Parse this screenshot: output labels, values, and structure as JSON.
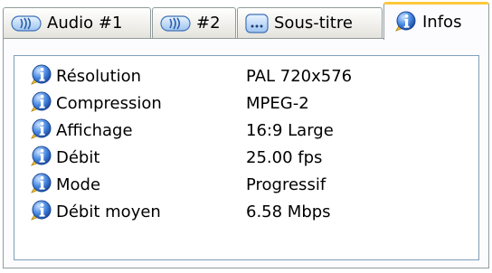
{
  "tabs": [
    {
      "label": "Audio #1",
      "icon": "audio-wave-icon",
      "active": false
    },
    {
      "label": "#2",
      "icon": "audio-wave-icon",
      "active": false
    },
    {
      "label": "Sous-titre",
      "icon": "subtitle-icon",
      "active": false
    },
    {
      "label": "Infos",
      "icon": "info-icon",
      "active": true
    }
  ],
  "info_rows": [
    {
      "name": "Résolution",
      "value": "PAL 720x576"
    },
    {
      "name": "Compression",
      "value": "MPEG-2"
    },
    {
      "name": "Affichage",
      "value": "16:9 Large"
    },
    {
      "name": "Débit",
      "value": "25.00 fps"
    },
    {
      "name": "Mode",
      "value": "Progressif"
    },
    {
      "name": "Débit moyen",
      "value": "6.58 Mbps"
    }
  ],
  "colors": {
    "active_tab_accent": "#ffc83c",
    "tab_border": "#919b9c",
    "list_border": "#7f9db9",
    "info_icon_blue": "#2f6fd6"
  }
}
